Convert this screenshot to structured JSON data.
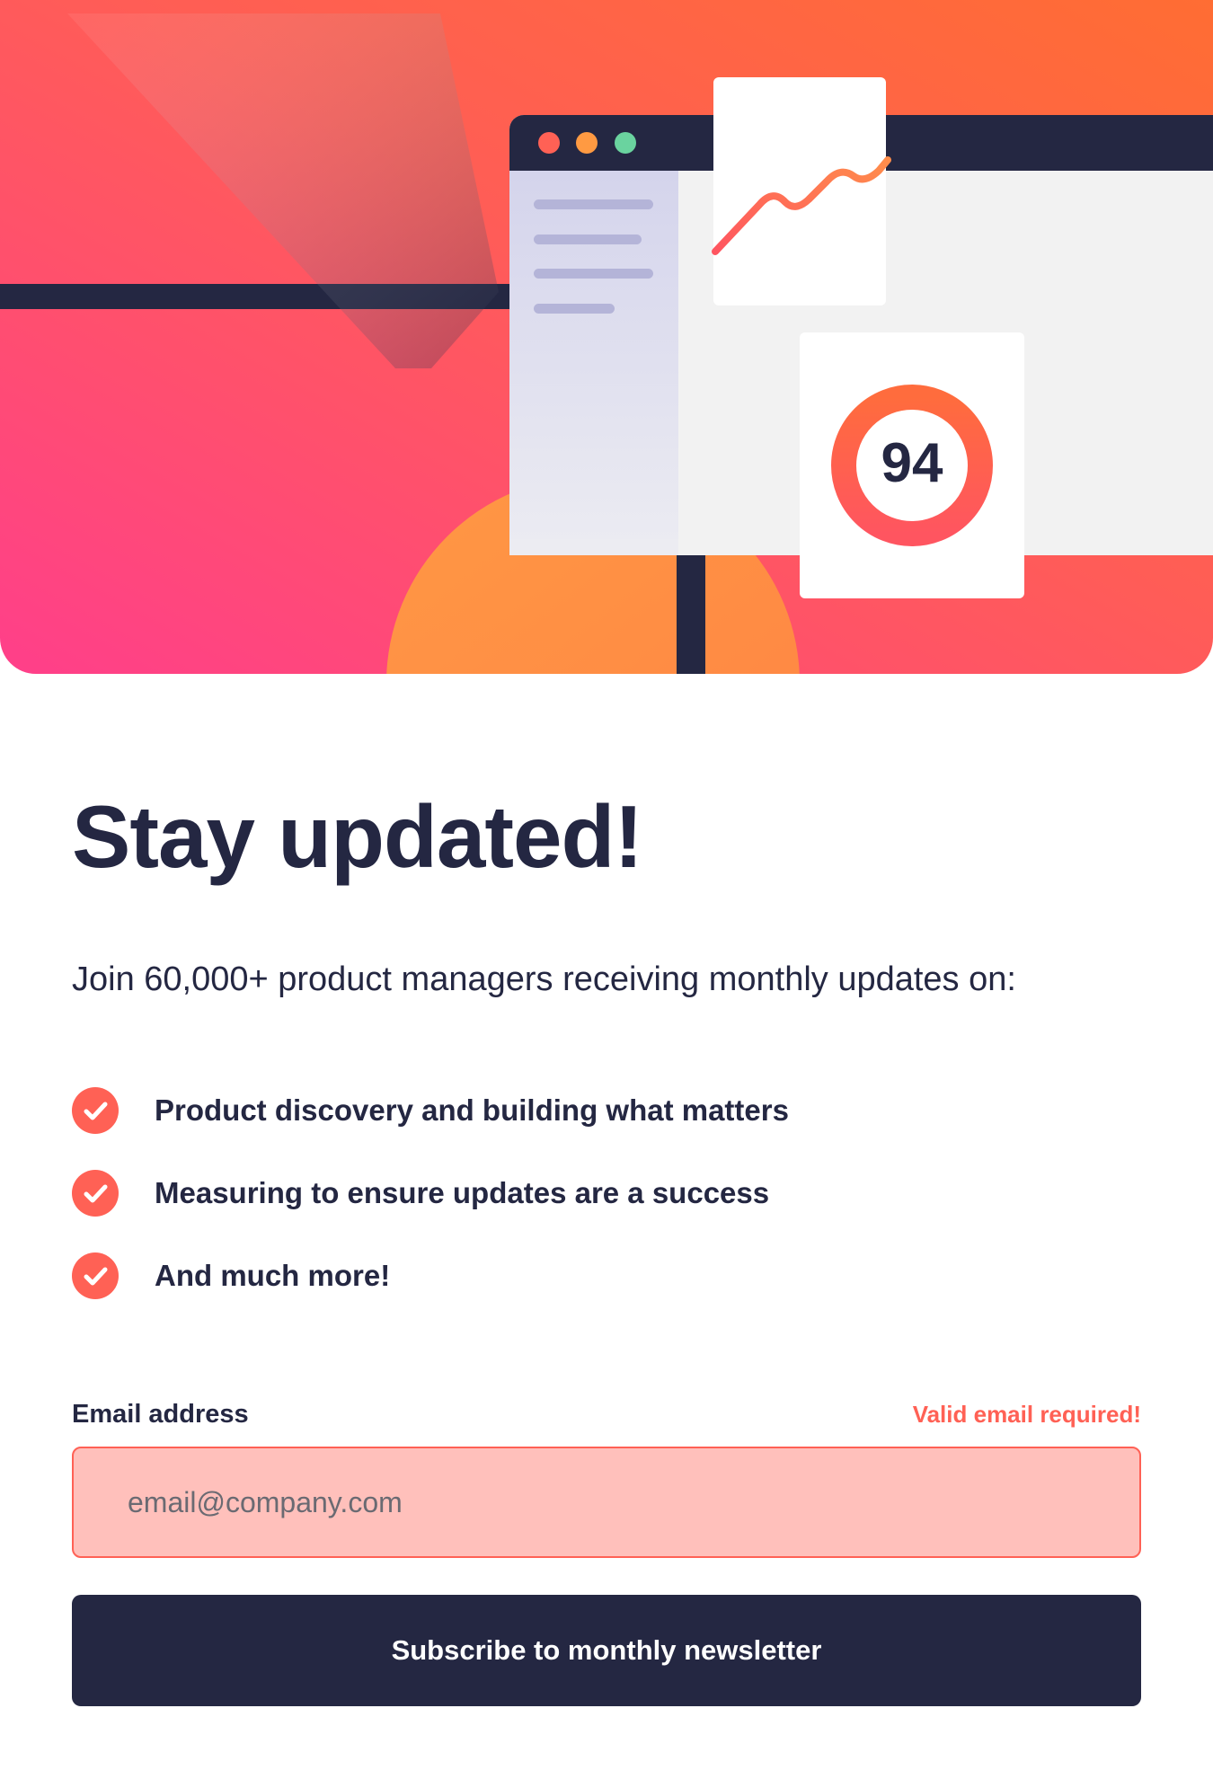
{
  "colors": {
    "accent": "#ff6155",
    "navy": "#242742",
    "error_bg": "#ffc0bb"
  },
  "illustration": {
    "score": "94",
    "icons": [
      "window-dots-icon",
      "line-chart-icon",
      "score-ring-icon"
    ]
  },
  "main": {
    "title": "Stay updated!",
    "intro": "Join 60,000+ product managers receiving monthly updates on:",
    "features": [
      {
        "text": "Product discovery and building what matters",
        "icon": "check-circle-icon"
      },
      {
        "text": "Measuring to ensure updates are a success",
        "icon": "check-circle-icon"
      },
      {
        "text": "And much more!",
        "icon": "check-circle-icon"
      }
    ]
  },
  "form": {
    "email_label": "Email address",
    "error": "Valid email required!",
    "email_placeholder": "email@company.com",
    "email_value": "",
    "submit_label": "Subscribe to monthly newsletter"
  }
}
